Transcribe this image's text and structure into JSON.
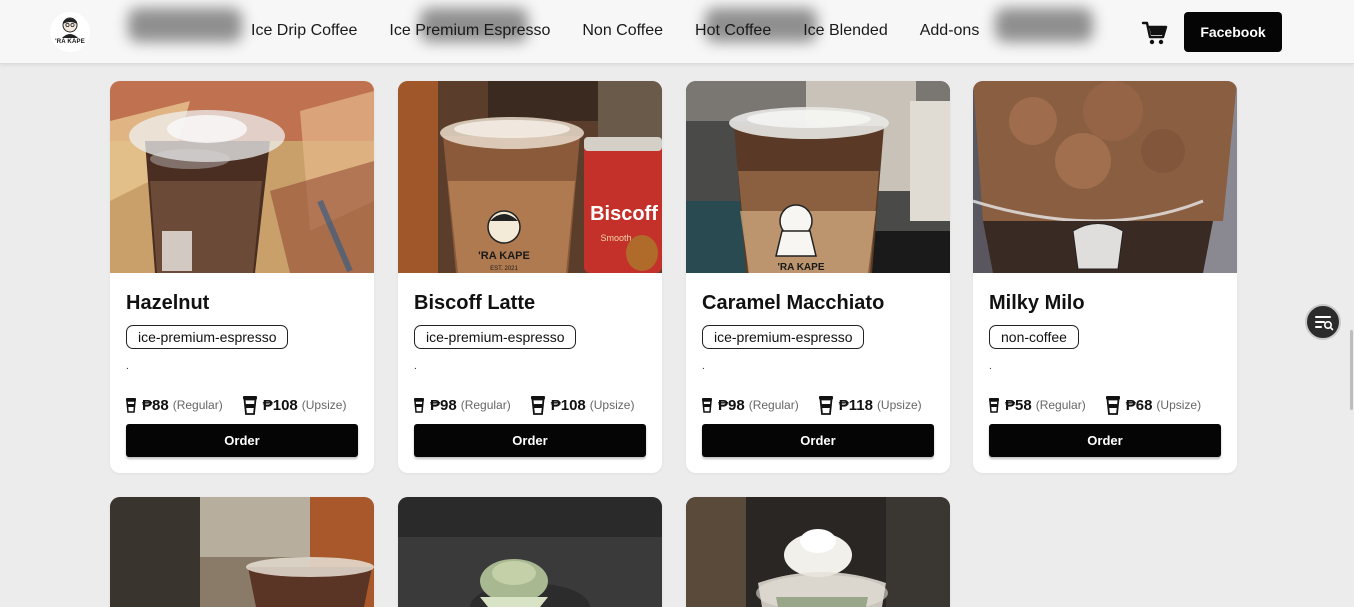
{
  "header": {
    "logo_text": "'RA KAPE",
    "nav": [
      "Ice Drip Coffee",
      "Ice Premium Espresso",
      "Non Coffee",
      "Hot Coffee",
      "Ice Blended",
      "Add-ons"
    ],
    "cart_icon": "cart-icon",
    "facebook_label": "Facebook"
  },
  "currency": "₱",
  "size_labels": {
    "regular": "(Regular)",
    "upsize": "(Upsize)"
  },
  "order_label": "Order",
  "products": [
    {
      "name": "Hazelnut",
      "category": "ice-premium-espresso",
      "description": ".",
      "regular": "₱88",
      "upsize": "₱108"
    },
    {
      "name": "Biscoff Latte",
      "category": "ice-premium-espresso",
      "description": ".",
      "regular": "₱98",
      "upsize": "₱108"
    },
    {
      "name": "Caramel Macchiato",
      "category": "ice-premium-espresso",
      "description": ".",
      "regular": "₱98",
      "upsize": "₱118"
    },
    {
      "name": "Milky Milo",
      "category": "non-coffee",
      "description": ".",
      "regular": "₱58",
      "upsize": "₱68"
    }
  ],
  "product_image_text": {
    "cup_brand": "'RA KAPE",
    "cup_est": "EST. 2021",
    "jar_label": "Biscoff",
    "jar_sub": "Smooth"
  },
  "fab_icon": "filter-list-icon",
  "colors": {
    "accent": "#050505",
    "background": "#ececec",
    "card": "#ffffff"
  }
}
